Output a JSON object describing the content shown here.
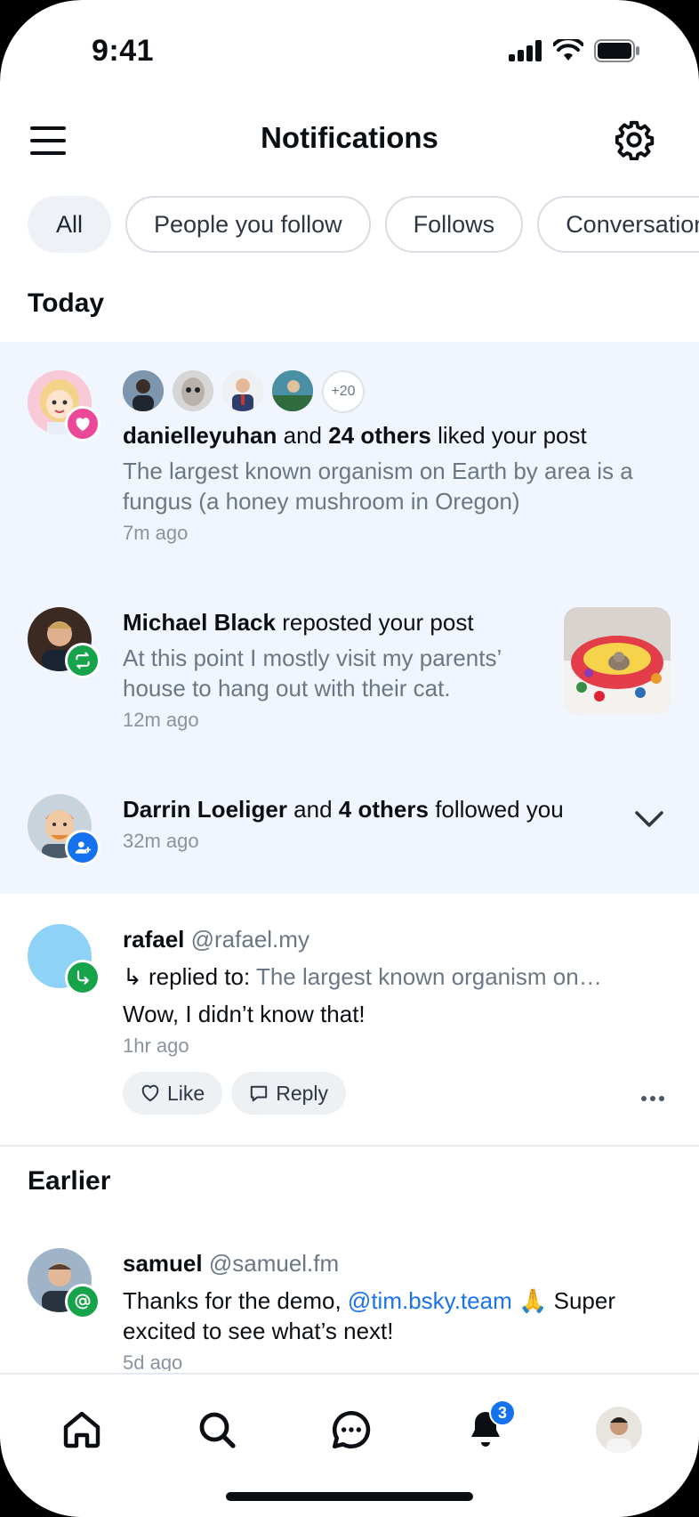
{
  "status_bar": {
    "time": "9:41"
  },
  "header": {
    "title": "Notifications"
  },
  "tabs": [
    "All",
    "People you follow",
    "Follows",
    "Conversations"
  ],
  "sections": {
    "today": "Today",
    "earlier": "Earlier"
  },
  "notifications": [
    {
      "user": "danielleyuhan",
      "connector": "and",
      "others": "24 others",
      "action": "liked your post",
      "snippet": "The largest known organism on Earth by area is a fungus (a honey mushroom in Oregon)",
      "time": "7m ago",
      "more_count": "+20"
    },
    {
      "user": "Michael Black",
      "action": "reposted your post",
      "snippet": "At this point I mostly visit my parents’ house to hang out with their cat.",
      "time": "12m ago"
    },
    {
      "user": "Darrin Loeliger",
      "connector": "and",
      "others": "4 others",
      "action": "followed you",
      "time": "32m ago"
    },
    {
      "user": "rafael",
      "handle": "@rafael.my",
      "reply_prefix": "↳ replied to:",
      "reply_target": "The largest known organism on…",
      "text": "Wow, I didn’t know that!",
      "time": "1hr ago",
      "like_label": "Like",
      "reply_label": "Reply"
    },
    {
      "user": "samuel",
      "handle": "@samuel.fm",
      "text_before": "Thanks for the demo,",
      "mention": "@tim.bsky.team",
      "text_after": "🙏 Super excited to see what’s next!",
      "time": "5d ago"
    }
  ],
  "bottom_nav": {
    "notifications_badge": "3"
  },
  "colors": {
    "accent": "#1572ef",
    "like_badge": "#ec4899",
    "repost_badge": "#16a34a",
    "follow_badge": "#1572ef",
    "unread_bg": "#f1f5fd"
  }
}
